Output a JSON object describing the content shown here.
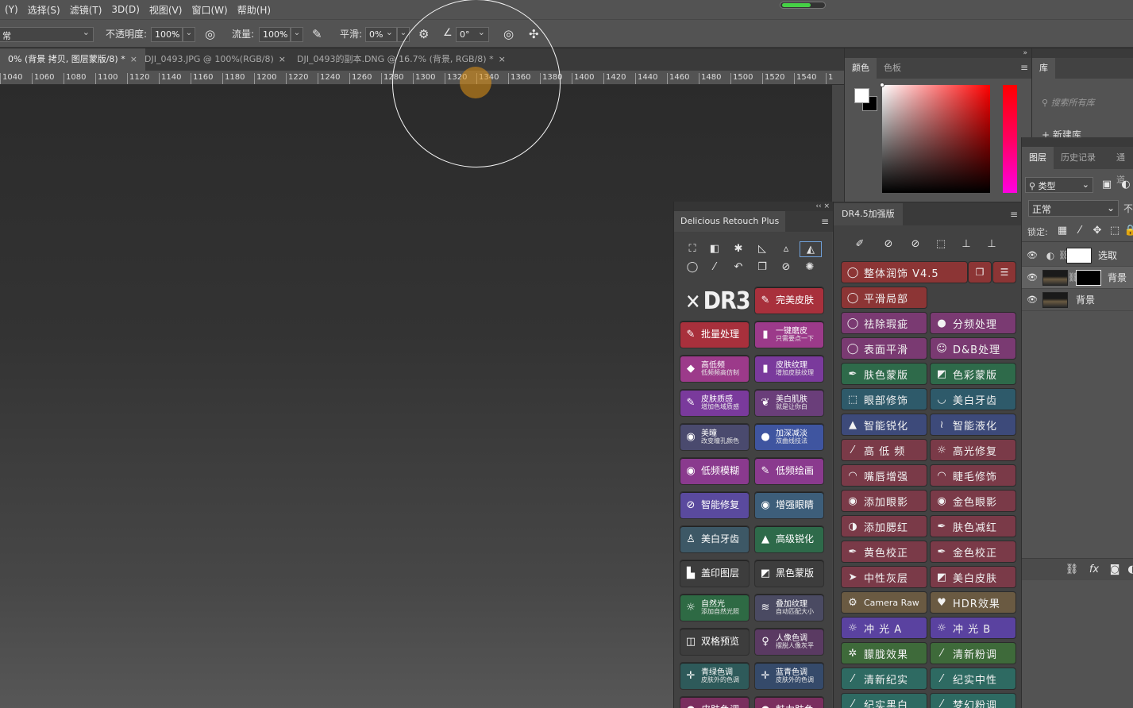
{
  "menu": [
    "(Y)",
    "选择(S)",
    "滤镜(T)",
    "3D(D)",
    "视图(V)",
    "窗口(W)",
    "帮助(H)"
  ],
  "options": {
    "blend_mode": "常",
    "opacity_label": "不透明度:",
    "opacity_value": "100%",
    "flow_label": "流量:",
    "flow_value": "100%",
    "smooth_label": "平滑:",
    "smooth_value": "0%",
    "angle_value": "0°"
  },
  "tabs": [
    {
      "label": "0% (背景 拷贝, 图层蒙版/8) *",
      "close": "×"
    },
    {
      "label": "DJI_0493.JPG @ 100%(RGB/8)",
      "close": "×"
    },
    {
      "label": "DJI_0493的副本.DNG @ 16.7% (背景, RGB/8) *",
      "close": "×"
    }
  ],
  "ruler": [
    "1040",
    "1060",
    "1080",
    "1100",
    "1120",
    "1140",
    "1160",
    "1180",
    "1200",
    "1220",
    "1240",
    "1260",
    "1280",
    "1300",
    "1320",
    "1340",
    "1360",
    "1380",
    "1400",
    "1420",
    "1440",
    "1460",
    "1480",
    "1500",
    "1520",
    "1540",
    "1"
  ],
  "dr_plus": {
    "collapse": "‹‹ ×",
    "title": "Delicious Retouch Plus",
    "logo": "DR3",
    "buttons": [
      {
        "icon": "brush-icon",
        "t1": "完美皮肤",
        "t2": "",
        "color": "#a8303c"
      },
      {
        "icon": "brush-icon",
        "t1": "批量处理",
        "t2": "",
        "color": "#a8303c"
      },
      {
        "icon": "bottle-icon",
        "t1": "一键磨皮",
        "t2": "只需要点一下",
        "color": "#9c3a8a"
      },
      {
        "icon": "diamond-icon",
        "t1": "高低频",
        "t2": "低频频高仿制",
        "color": "#9c3a8a"
      },
      {
        "icon": "tube-icon",
        "t1": "皮肤纹理",
        "t2": "增加皮肤纹理",
        "color": "#7a3a9c"
      },
      {
        "icon": "brush-icon",
        "t1": "皮肤质感",
        "t2": "增加色域质感",
        "color": "#7a3a9c"
      },
      {
        "icon": "feather-icon",
        "t1": "美白肌肤",
        "t2": "就是让你白",
        "color": "#6a3e7a"
      },
      {
        "icon": "eye-icon",
        "t1": "美瞳",
        "t2": "改变瞳孔颜色",
        "color": "#4a4a6e"
      },
      {
        "icon": "circle-icon",
        "t1": "加深减淡",
        "t2": "双曲线技法",
        "color": "#3f55a0"
      },
      {
        "icon": "eye-icon",
        "t1": "低频模糊",
        "t2": "",
        "color": "#8a3a8e"
      },
      {
        "icon": "brush-icon",
        "t1": "低频绘画",
        "t2": "",
        "color": "#8a3a8e"
      },
      {
        "icon": "bandage-icon",
        "t1": "智能修复",
        "t2": "",
        "color": "#5a4a9e"
      },
      {
        "icon": "eye-icon",
        "t1": "增强眼睛",
        "t2": "",
        "color": "#3d5e7a"
      },
      {
        "icon": "tooth-icon",
        "t1": "美白牙齿",
        "t2": "",
        "color": "#3d5866"
      },
      {
        "icon": "triangle-icon",
        "t1": "高级锐化",
        "t2": "",
        "color": "#2e6a4a"
      },
      {
        "icon": "stamp-icon",
        "t1": "盖印图层",
        "t2": "",
        "color": "#3d3d3d"
      },
      {
        "icon": "mask-icon",
        "t1": "黑色蒙版",
        "t2": "",
        "color": "#3d3d3d"
      },
      {
        "icon": "sun-icon",
        "t1": "自然光",
        "t2": "添加自然光照",
        "color": "#2e6a44"
      },
      {
        "icon": "texture-icon",
        "t1": "叠加纹理",
        "t2": "自动匹配大小",
        "color": "#4a4a62"
      },
      {
        "icon": "split-icon",
        "t1": "双格预览",
        "t2": "",
        "color": "#3d3d3d"
      },
      {
        "icon": "person-icon",
        "t1": "人像色调",
        "t2": "摆脱人像灰平",
        "color": "#5a3a62"
      },
      {
        "icon": "cross-icon",
        "t1": "青绿色调",
        "t2": "皮肤外的色调",
        "color": "#2e5a5a"
      },
      {
        "icon": "cross-icon",
        "t1": "蓝青色调",
        "t2": "皮肤外的色调",
        "color": "#354a6a"
      },
      {
        "icon": "circle-icon",
        "t1": "皮肤色调",
        "t2": "",
        "color": "#7a2e5e"
      },
      {
        "icon": "circle-icon",
        "t1": "魅力肤色",
        "t2": "",
        "color": "#7a2e5e"
      }
    ]
  },
  "dr45": {
    "collapse": "‹‹ ×",
    "title": "DR4.5加强版",
    "buttons": [
      {
        "icon": "lasso-icon",
        "t": "整体润饰 V4.5",
        "color": "#8c3535"
      },
      {
        "icon": "lasso-icon",
        "t": "平滑局部",
        "color": "#8c3535"
      },
      {
        "icon": "lasso-icon",
        "t": "祛除瑕疵",
        "color": "#7a3a72"
      },
      {
        "icon": "circle-icon",
        "t": "分频处理",
        "color": "#7a3a72"
      },
      {
        "icon": "lasso-icon",
        "t": "表面平滑",
        "color": "#7a3a72"
      },
      {
        "icon": "face-icon",
        "t": "D&B处理",
        "color": "#7a3a72"
      },
      {
        "icon": "dropper-icon",
        "t": "肤色蒙版",
        "color": "#2e6a4a"
      },
      {
        "icon": "mask-icon",
        "t": "色彩蒙版",
        "color": "#2e6a4a"
      },
      {
        "icon": "select-icon",
        "t": "眼部修饰",
        "color": "#2e5a6a"
      },
      {
        "icon": "mouth-icon",
        "t": "美白牙齿",
        "color": "#2e5a6a"
      },
      {
        "icon": "triangle-icon",
        "t": "智能锐化",
        "color": "#3d4a7a"
      },
      {
        "icon": "wave-icon",
        "t": "智能液化",
        "color": "#3d4a7a"
      },
      {
        "icon": "wand-icon",
        "t": "高 低 频",
        "color": "#7a3a48"
      },
      {
        "icon": "sun-icon",
        "t": "高光修复",
        "color": "#7a3a48"
      },
      {
        "icon": "lips-icon",
        "t": "嘴唇增强",
        "color": "#7a3a48"
      },
      {
        "icon": "eyelash-icon",
        "t": "睫毛修饰",
        "color": "#7a3a48"
      },
      {
        "icon": "eye-icon",
        "t": "添加眼影",
        "color": "#7a3a48"
      },
      {
        "icon": "eye-icon",
        "t": "金色眼影",
        "color": "#7a3a48"
      },
      {
        "icon": "blush-icon",
        "t": "添加腮红",
        "color": "#7a3a48"
      },
      {
        "icon": "pen-icon",
        "t": "肤色减红",
        "color": "#7a3a48"
      },
      {
        "icon": "pen-icon",
        "t": "黄色校正",
        "color": "#7a3a48"
      },
      {
        "icon": "pen-icon",
        "t": "金色校正",
        "color": "#7a3a48"
      },
      {
        "icon": "cursor-icon",
        "t": "中性灰层",
        "color": "#7a3a48"
      },
      {
        "icon": "mask-icon",
        "t": "美白皮肤",
        "color": "#7a3a48"
      },
      {
        "icon": "gear-icon",
        "t": "Camera Raw",
        "color": "#6a5a42"
      },
      {
        "icon": "heart-icon",
        "t": "HDR效果",
        "color": "#6a5a42"
      },
      {
        "icon": "sun-icon",
        "t": "冲 光 A",
        "color": "#5a42a0"
      },
      {
        "icon": "sun-icon",
        "t": "冲 光 B",
        "color": "#5a42a0"
      },
      {
        "icon": "snow-icon",
        "t": "朦胧效果",
        "color": "#3e6a3a"
      },
      {
        "icon": "wand-icon",
        "t": "清新粉调",
        "color": "#3e6a3a"
      },
      {
        "icon": "wand-icon",
        "t": "清新纪实",
        "color": "#2e6a62"
      },
      {
        "icon": "wand-icon",
        "t": "纪实中性",
        "color": "#2e6a62"
      },
      {
        "icon": "wand-icon",
        "t": "纪实黑白",
        "color": "#2e6a62"
      },
      {
        "icon": "wand-icon",
        "t": "梦幻粉调",
        "color": "#2e6a62"
      }
    ]
  },
  "color_panel": {
    "tabs": [
      "颜色",
      "色板"
    ],
    "collapse": "»"
  },
  "library": {
    "tab": "库",
    "search": "搜索所有库",
    "new": "+ 新建库"
  },
  "layers": {
    "tabs": [
      "图层",
      "历史记录",
      "通道"
    ],
    "filter": "类型",
    "blend": "正常",
    "opacity_short": "不",
    "lock_label": "锁定:",
    "rows": [
      {
        "name": "选取",
        "sel": false
      },
      {
        "name": "背景",
        "sel": true
      },
      {
        "name": "背景",
        "sel": false
      }
    ]
  }
}
